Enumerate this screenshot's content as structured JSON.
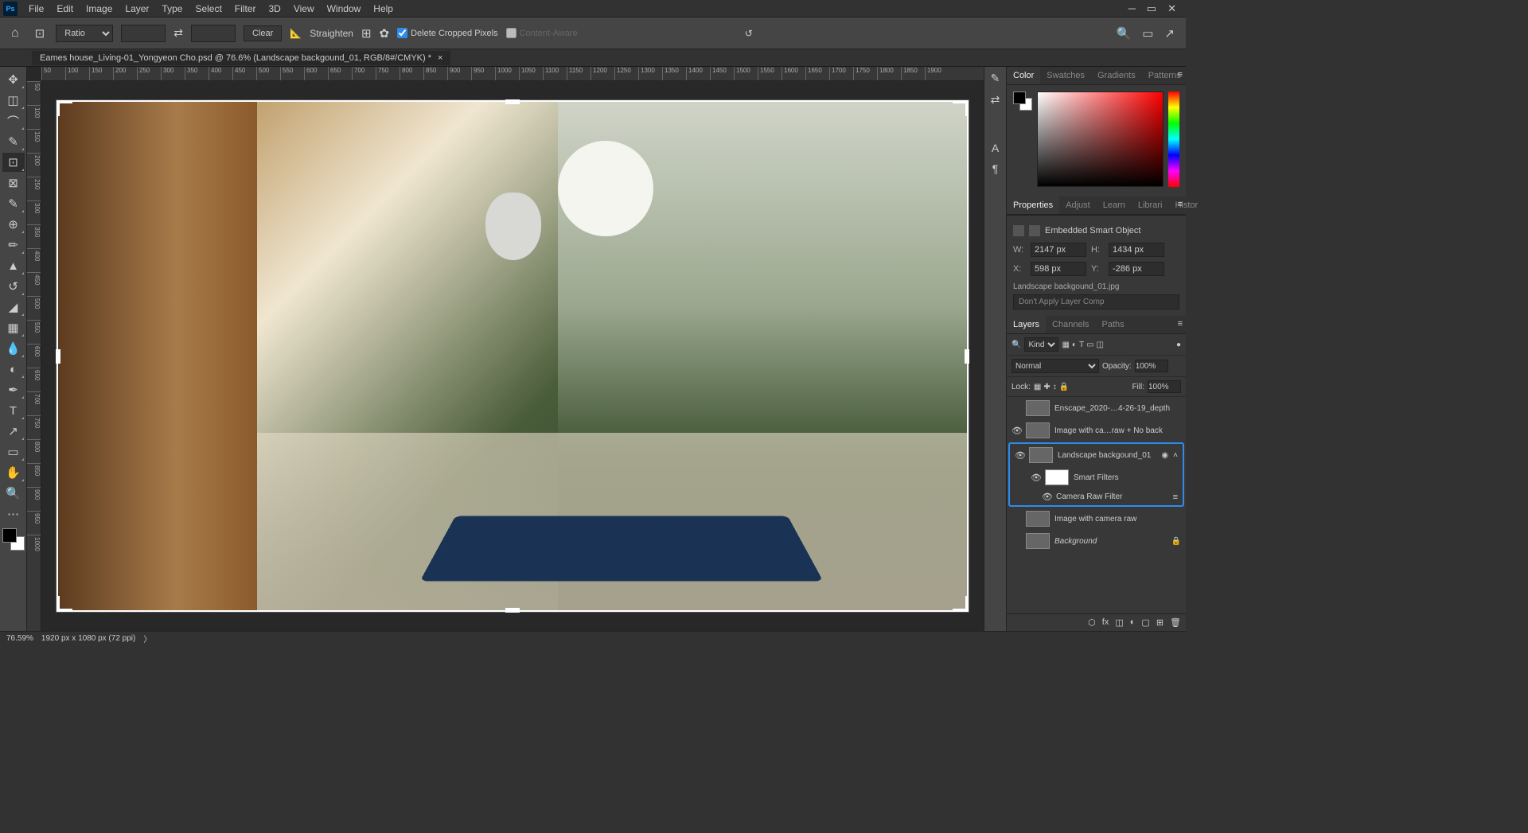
{
  "menu": {
    "items": [
      "File",
      "Edit",
      "Image",
      "Layer",
      "Type",
      "Select",
      "Filter",
      "3D",
      "View",
      "Window",
      "Help"
    ]
  },
  "options": {
    "ratio_label": "Ratio",
    "clear": "Clear",
    "straighten": "Straighten",
    "delete_cropped": "Delete Cropped Pixels",
    "content_aware": "Content-Aware"
  },
  "doc_tab": {
    "title": "Eames house_Living-01_Yongyeon Cho.psd @ 76.6% (Landscape backgound_01, RGB/8#/CMYK) *"
  },
  "ruler_h": [
    "50",
    "100",
    "150",
    "200",
    "250",
    "300",
    "350",
    "400",
    "450",
    "500",
    "550",
    "600",
    "650",
    "700",
    "750",
    "800",
    "850",
    "900",
    "950",
    "1000",
    "1050",
    "1100",
    "1150",
    "1200",
    "1250",
    "1300",
    "1350",
    "1400",
    "1450",
    "1500",
    "1550",
    "1600",
    "1650",
    "1700",
    "1750",
    "1800",
    "1850",
    "1900"
  ],
  "ruler_v": [
    "50",
    "100",
    "150",
    "200",
    "250",
    "300",
    "350",
    "400",
    "450",
    "500",
    "550",
    "600",
    "650",
    "700",
    "750",
    "800",
    "850",
    "900",
    "950",
    "1000"
  ],
  "panels": {
    "color": {
      "tabs": [
        "Color",
        "Swatches",
        "Gradients",
        "Patterns"
      ]
    },
    "props": {
      "tabs": [
        "Properties",
        "Adjust",
        "Learn",
        "Librari",
        "Histor"
      ],
      "title": "Embedded Smart Object",
      "w_label": "W:",
      "w_val": "2147 px",
      "h_label": "H:",
      "h_val": "1434 px",
      "x_label": "X:",
      "x_val": "598 px",
      "y_label": "Y:",
      "y_val": "-286 px",
      "filename": "Landscape backgound_01.jpg",
      "comp": "Don't Apply Layer Comp"
    },
    "layers": {
      "tabs": [
        "Layers",
        "Channels",
        "Paths"
      ],
      "kind": "Kind",
      "blend": "Normal",
      "opacity_label": "Opacity:",
      "opacity": "100%",
      "lock_label": "Lock:",
      "fill_label": "Fill:",
      "fill": "100%",
      "items": [
        {
          "eye": false,
          "name": "Enscape_2020-…4-26-19_depth"
        },
        {
          "eye": true,
          "name": "Image with ca…raw + No back"
        },
        {
          "eye": true,
          "name": "Landscape backgound_01",
          "selected": true,
          "expand": true
        },
        {
          "eye": true,
          "name": "Smart Filters",
          "indent": 1,
          "white": true
        },
        {
          "eye": true,
          "name": "Camera Raw Filter",
          "indent": 2,
          "sliders": true
        },
        {
          "eye": false,
          "name": "Image with camera raw"
        },
        {
          "eye": false,
          "name": "Background",
          "italic": true,
          "lock": true
        }
      ]
    }
  },
  "status": {
    "zoom": "76.59%",
    "dim": "1920 px x 1080 px (72 ppi)"
  }
}
